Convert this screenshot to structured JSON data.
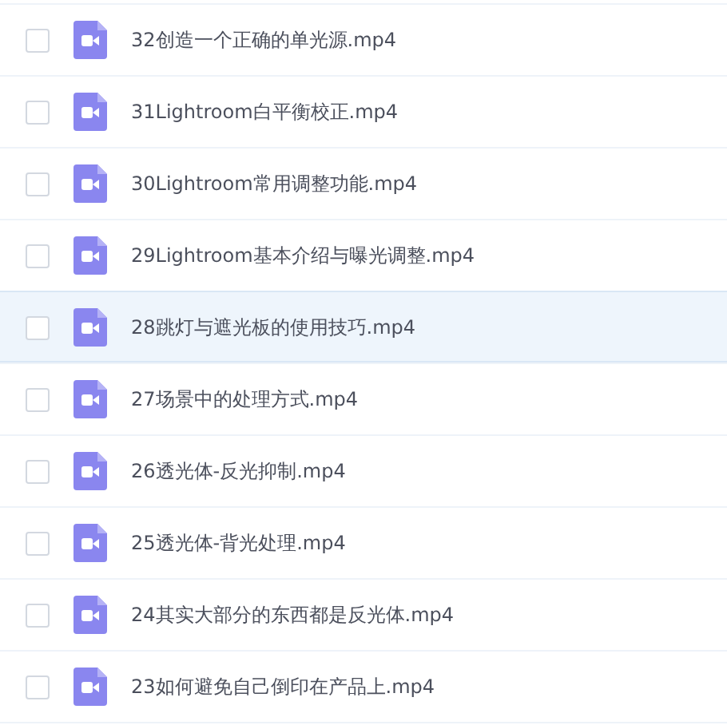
{
  "files": [
    {
      "name": "32创造一个正确的单光源.mp4",
      "checked": false,
      "highlighted": false
    },
    {
      "name": "31Lightroom白平衡校正.mp4",
      "checked": false,
      "highlighted": false
    },
    {
      "name": "30Lightroom常用调整功能.mp4",
      "checked": false,
      "highlighted": false
    },
    {
      "name": "29Lightroom基本介绍与曝光调整.mp4",
      "checked": false,
      "highlighted": false
    },
    {
      "name": "28跳灯与遮光板的使用技巧.mp4",
      "checked": false,
      "highlighted": true
    },
    {
      "name": "27场景中的处理方式.mp4",
      "checked": false,
      "highlighted": false
    },
    {
      "name": "26透光体-反光抑制.mp4",
      "checked": false,
      "highlighted": false
    },
    {
      "name": "25透光体-背光处理.mp4",
      "checked": false,
      "highlighted": false
    },
    {
      "name": "24其实大部分的东西都是反光体.mp4",
      "checked": false,
      "highlighted": false
    },
    {
      "name": "23如何避免自己倒印在产品上.mp4",
      "checked": false,
      "highlighted": false
    }
  ]
}
